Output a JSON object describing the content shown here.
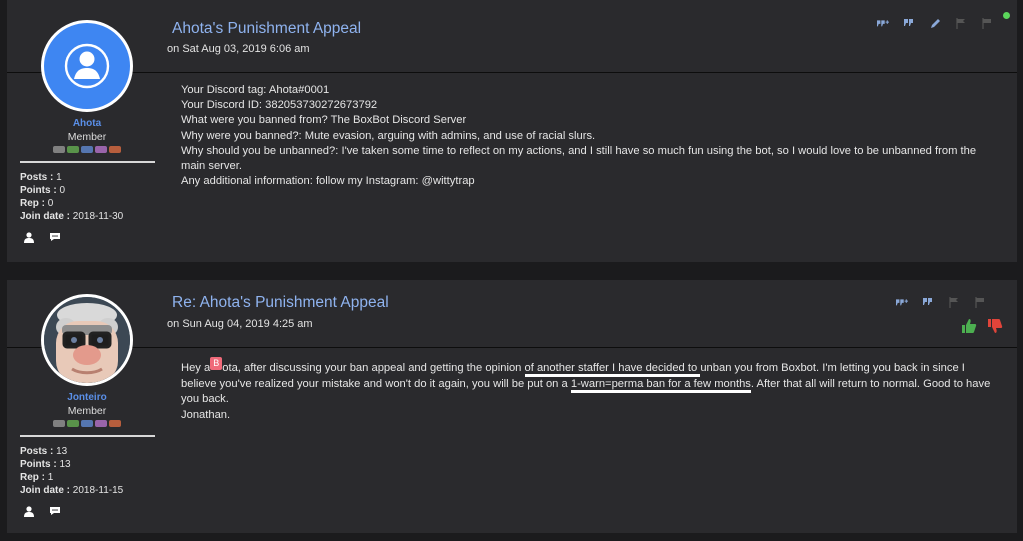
{
  "posts": [
    {
      "title": "Ahota's Punishment Appeal",
      "date_prefix": "on",
      "date": "Sat Aug 03, 2019 6:06 am",
      "author": {
        "name": "Ahota",
        "rank": "Member",
        "stats": [
          {
            "label": "Posts :",
            "value": "1"
          },
          {
            "label": "Points :",
            "value": "0"
          },
          {
            "label": "Rep :",
            "value": "0"
          },
          {
            "label": "Join date :",
            "value": "2018-11-30"
          }
        ]
      },
      "body_lines": [
        "Your Discord tag: Ahota#0001",
        "Your Discord ID: 382053730272673792",
        "What were you banned from? The BoxBot Discord Server",
        "Why were you banned?: Mute evasion, arguing with admins, and use of racial slurs.",
        "Why should you be unbanned?: I've taken some time to reflect on my actions, and I still have so much fun using the bot, so I would love to be unbanned from the main server.",
        "Any additional information: follow my Instagram: @wittytrap"
      ]
    },
    {
      "title": "Re: Ahota's Punishment Appeal",
      "date_prefix": "on",
      "date": "Sun Aug 04, 2019 4:25 am",
      "author": {
        "name": "Jonteiro",
        "rank": "Member",
        "stats": [
          {
            "label": "Posts :",
            "value": "13"
          },
          {
            "label": "Points :",
            "value": "13"
          },
          {
            "label": "Rep :",
            "value": "1"
          },
          {
            "label": "Join date :",
            "value": "2018-11-15"
          }
        ]
      },
      "body": {
        "p1": "Hey a",
        "badge": "B",
        "p2": "ota, after discussing your ban appeal and getting the opinion ",
        "u1": "of another staffer I have decided to ",
        "p3": "unban you from Boxbot. I'm letting you back in since I believe you've realized your mistake and won't do it again, you will be put on a ",
        "u2": "1-warn=perma ban for a few months",
        "p4": ". After that all will return to normal. Good to have you back.",
        "sign": "Jonathan."
      }
    }
  ],
  "icons": {
    "quote_multi": "multi-quote-icon",
    "quote": "quote-icon",
    "edit": "edit-icon",
    "report": "flag-icon",
    "warn": "warn-flag-icon",
    "profile": "profile-icon",
    "pm": "message-icon",
    "like": "thumbs-up-icon",
    "dislike": "thumbs-down-icon"
  },
  "colors": {
    "link": "#8fb3ef",
    "username": "#5a8fe8",
    "online": "#5bd65b",
    "like": "#4caf50",
    "dislike": "#e0443a"
  }
}
